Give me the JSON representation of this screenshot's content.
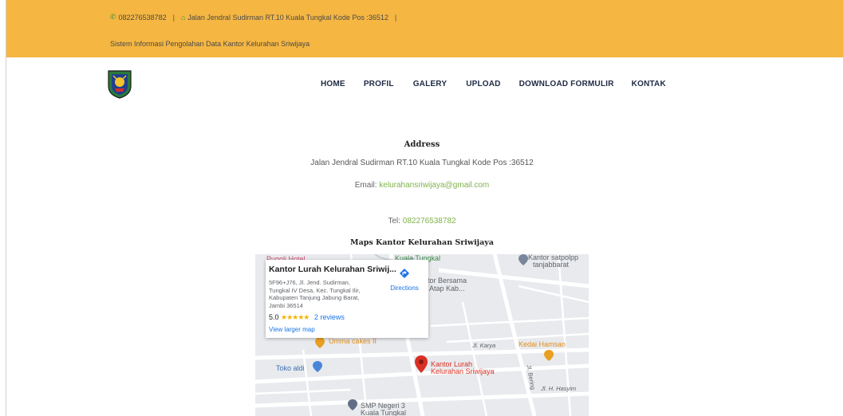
{
  "topbar": {
    "phone": "082276538782",
    "separator": "|",
    "address": "Jalan Jendral Sudirman RT.10 Kuala Tungkal Kode Pos :36512",
    "tagline": "Sistem Informasi Pengolahan Data Kantor Kelurahan Sriwijaya",
    "background": "#f5b642"
  },
  "nav": {
    "items": [
      "HOME",
      "PROFIL",
      "GALERY",
      "UPLOAD",
      "DOWNLOAD FORMULIR",
      "KONTAK"
    ]
  },
  "contact": {
    "address_title": "Address",
    "address_text": "Jalan Jendral Sudirman RT.10 Kuala Tungkal Kode Pos :36512",
    "email_label": "Email: ",
    "email": "kelurahansriwijaya@gmail.com",
    "tel_label": "Tel: ",
    "tel": "082276538782",
    "maps_title": "Maps Kantor Kelurahan Sriwijaya",
    "accent": "#7fb24a"
  },
  "map": {
    "card_title": "Kantor Lurah Kelurahan Sriwij...",
    "card_address": "5F96+J76, Jl. Jend. Sudirman, Tungkal IV Desa, Kec. Tungkal Ilir, Kabupaten Tanjung Jabung Barat, Jambi 36514",
    "rating": "5.0",
    "stars": "★★★★★",
    "reviews": "2 reviews",
    "view_larger": "View larger map",
    "directions": "Directions",
    "labels": {
      "hotel": "Pugoli Hotel",
      "kuala_tungkal": "Kuala Tungkal",
      "satpolpp_1": "Kantor satpolpp",
      "satpolpp_2": "tanjabbarat",
      "bersama_1": "tor Bersama",
      "bersama_2": "Atap Kab...",
      "umma": "Umma cakes II",
      "jl_karya": "Jl. Karya",
      "kedai": "Kedai Hamsan",
      "toko": "Toko aldi",
      "pin_1": "Kantor Lurah",
      "pin_2": "Kelurahan Sriwijaya",
      "jl_bering": "Jl. Bering",
      "jl_hasyim": "Jl. H. Hasyim",
      "smp_1": "SMP Negeri 3",
      "smp_2": "Kuala Tungkal"
    }
  }
}
